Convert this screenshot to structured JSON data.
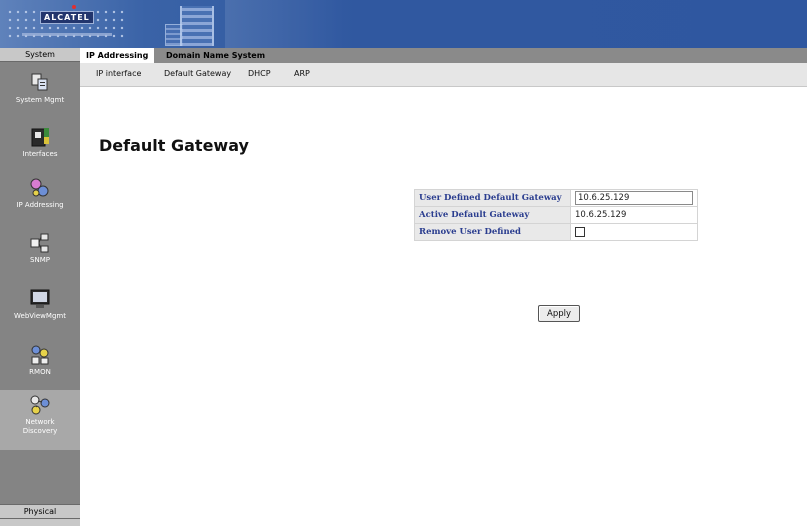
{
  "banner": {
    "brand": "ALCATEL",
    "brand_color": "#2f57a0",
    "icons": [
      "dot-grid-graphic",
      "building-graphic"
    ]
  },
  "sidebar": {
    "header": "System",
    "items": [
      {
        "label": "System Mgmt",
        "icon": "system-mgmt-icon"
      },
      {
        "label": "Interfaces",
        "icon": "interfaces-icon"
      },
      {
        "label": "IP Addressing",
        "icon": "ip-addressing-icon"
      },
      {
        "label": "SNMP",
        "icon": "snmp-icon"
      },
      {
        "label": "WebViewMgmt",
        "icon": "webview-mgmt-icon"
      },
      {
        "label": "RMON",
        "icon": "rmon-icon"
      },
      {
        "label": "Network Discovery",
        "icon": "network-discovery-icon"
      }
    ],
    "footer": "Physical"
  },
  "tabs": [
    {
      "label": "IP Addressing",
      "active": true
    },
    {
      "label": "Domain Name System",
      "active": false
    }
  ],
  "subtabs": [
    "IP interface",
    "Default Gateway",
    "DHCP",
    "ARP"
  ],
  "page": {
    "title": "Default Gateway",
    "rows": [
      {
        "label": "User Defined Default Gateway",
        "value": "10.6.25.129",
        "kind": "input"
      },
      {
        "label": "Active Default Gateway",
        "value": "10.6.25.129",
        "kind": "text"
      },
      {
        "label": "Remove User Defined",
        "value": false,
        "kind": "checkbox"
      }
    ],
    "apply_label": "Apply"
  }
}
